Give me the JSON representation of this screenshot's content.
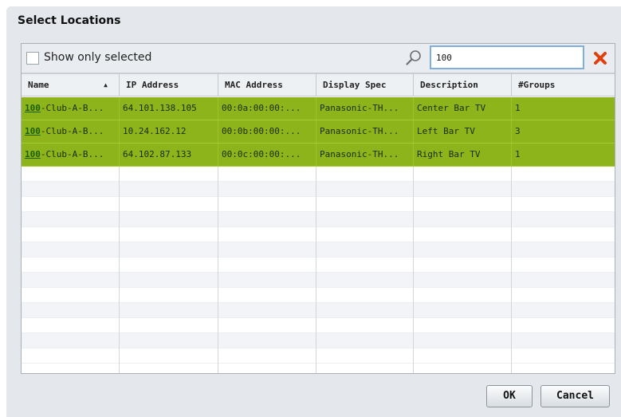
{
  "dialog": {
    "title": "Select Locations"
  },
  "toolbar": {
    "show_only_selected_label": "Show only selected",
    "show_only_selected_checked": false,
    "search_value": "100",
    "search_icon": "search-icon",
    "clear_icon": "clear-icon",
    "clear_color": "#e0400e"
  },
  "table": {
    "columns": [
      {
        "label": "Name",
        "sort": "ascending"
      },
      {
        "label": "IP Address"
      },
      {
        "label": "MAC Address"
      },
      {
        "label": "Display Spec"
      },
      {
        "label": "Description"
      },
      {
        "label": "#Groups"
      }
    ],
    "rows": [
      {
        "name_match": "100",
        "name_rest": "-Club-A-B...",
        "ip": "64.101.138.105",
        "mac": "00:0a:00:00:...",
        "display_spec": "Panasonic-TH...",
        "description": "Center Bar TV",
        "groups": "1"
      },
      {
        "name_match": "100",
        "name_rest": "-Club-A-B...",
        "ip": "10.24.162.12",
        "mac": "00:0b:00:00:...",
        "display_spec": "Panasonic-TH...",
        "description": "Left Bar TV",
        "groups": "3"
      },
      {
        "name_match": "100",
        "name_rest": "-Club-A-B...",
        "ip": "64.102.87.133",
        "mac": "00:0c:00:00:...",
        "display_spec": "Panasonic-TH...",
        "description": "Right Bar TV",
        "groups": "1"
      }
    ],
    "selected_row_color": "#8db51b"
  },
  "buttons": {
    "ok_label": "OK",
    "cancel_label": "Cancel"
  }
}
